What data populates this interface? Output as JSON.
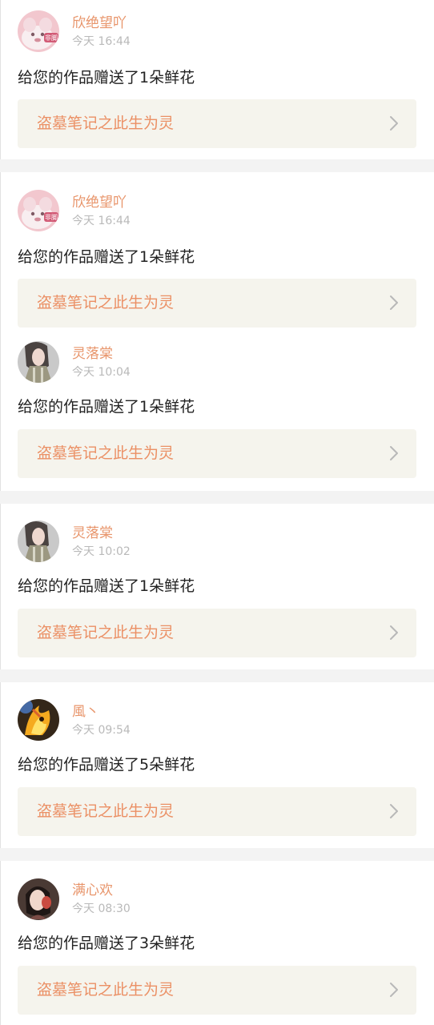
{
  "notifications": [
    {
      "username": "欣绝望吖",
      "time": "今天 16:44",
      "message": "给您的作品赠送了1朵鲜花",
      "work_title": "盗墓笔记之此生为灵",
      "avatar": "avatar-pink-cat",
      "avatar_badge": "非脚"
    },
    {
      "username": "欣绝望吖",
      "time": "今天 16:44",
      "message": "给您的作品赠送了1朵鲜花",
      "work_title": "盗墓笔记之此生为灵",
      "avatar": "avatar-pink-cat",
      "avatar_badge": "非脚"
    },
    {
      "username": "灵落棠",
      "time": "今天 10:04",
      "message": "给您的作品赠送了1朵鲜花",
      "work_title": "盗墓笔记之此生为灵",
      "avatar": "avatar-girl-dress"
    },
    {
      "username": "灵落棠",
      "time": "今天 10:02",
      "message": "给您的作品赠送了1朵鲜花",
      "work_title": "盗墓笔记之此生为灵",
      "avatar": "avatar-girl-dress"
    },
    {
      "username": "風丶",
      "time": "今天 09:54",
      "message": "给您的作品赠送了5朵鲜花",
      "work_title": "盗墓笔记之此生为灵",
      "avatar": "avatar-fire-cartoon"
    },
    {
      "username": "满心欢",
      "time": "今天 08:30",
      "message": "给您的作品赠送了3朵鲜花",
      "work_title": "盗墓笔记之此生为灵",
      "avatar": "avatar-dark-girl"
    }
  ],
  "colors": {
    "username": "#e8956b",
    "time": "#b9b9b9",
    "message": "#222222",
    "work_bg": "#f5f4ed",
    "work_title": "#eb9065",
    "divider": "#f3f3f3"
  }
}
